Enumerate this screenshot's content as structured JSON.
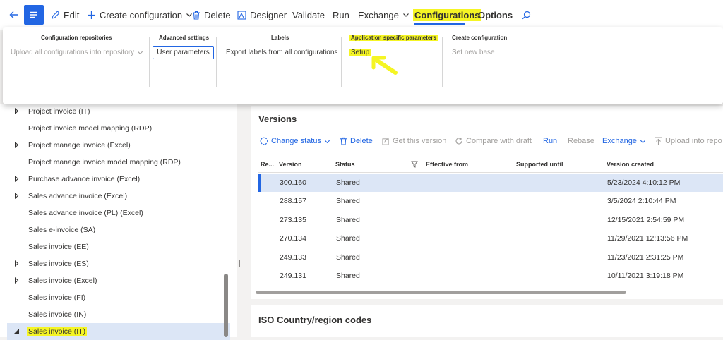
{
  "commandbar": {
    "edit": "Edit",
    "create_configuration": "Create configuration",
    "delete": "Delete",
    "designer": "Designer",
    "validate": "Validate",
    "run": "Run",
    "exchange": "Exchange",
    "configurations_tab": "Configurations",
    "options_tab": "Options"
  },
  "ribbon": {
    "groups": [
      {
        "title": "Configuration repositories",
        "items": [
          "Upload all configurations into repository"
        ]
      },
      {
        "title": "Advanced settings",
        "items": [
          "User parameters"
        ]
      },
      {
        "title": "Labels",
        "items": [
          "Export labels from all configurations"
        ]
      },
      {
        "title": "Application specific parameters",
        "items": [
          "Setup"
        ]
      },
      {
        "title": "Create configuration",
        "items": [
          "Set new base"
        ]
      }
    ]
  },
  "tree": {
    "items": [
      {
        "label": "Project invoice (IT)",
        "toggle": "collapsed"
      },
      {
        "label": "Project invoice model mapping (RDP)",
        "toggle": "none"
      },
      {
        "label": "Project manage invoice (Excel)",
        "toggle": "collapsed"
      },
      {
        "label": "Project manage invoice model mapping (RDP)",
        "toggle": "none"
      },
      {
        "label": "Purchase advance invoice (Excel)",
        "toggle": "collapsed"
      },
      {
        "label": "Sales advance invoice (Excel)",
        "toggle": "collapsed"
      },
      {
        "label": "Sales advance invoice (PL) (Excel)",
        "toggle": "none"
      },
      {
        "label": "Sales e-invoice (SA)",
        "toggle": "none"
      },
      {
        "label": "Sales invoice (EE)",
        "toggle": "none"
      },
      {
        "label": "Sales invoice (ES)",
        "toggle": "collapsed"
      },
      {
        "label": "Sales invoice (Excel)",
        "toggle": "collapsed"
      },
      {
        "label": "Sales invoice (FI)",
        "toggle": "none"
      },
      {
        "label": "Sales invoice (IN)",
        "toggle": "none"
      },
      {
        "label": "Sales invoice (IT)",
        "toggle": "expanded",
        "selected": true
      }
    ]
  },
  "versions": {
    "title": "Versions",
    "toolbar": {
      "change_status": "Change status",
      "delete": "Delete",
      "get_this_version": "Get this version",
      "compare_with_draft": "Compare with draft",
      "run": "Run",
      "rebase": "Rebase",
      "exchange": "Exchange",
      "upload_into_repo": "Upload into repo"
    },
    "columns": [
      "Re...",
      "Version",
      "Status",
      "Effective from",
      "Supported until",
      "Version created"
    ],
    "rows": [
      {
        "version": "300.160",
        "status": "Shared",
        "created": "5/23/2024 4:10:12 PM"
      },
      {
        "version": "288.157",
        "status": "Shared",
        "created": "3/5/2024 2:10:44 PM"
      },
      {
        "version": "273.135",
        "status": "Shared",
        "created": "12/15/2021 2:54:59 PM"
      },
      {
        "version": "270.134",
        "status": "Shared",
        "created": "11/29/2021 12:13:56 PM"
      },
      {
        "version": "249.133",
        "status": "Shared",
        "created": "11/23/2021 2:31:25 PM"
      },
      {
        "version": "249.131",
        "status": "Shared",
        "created": "10/11/2021 3:19:18 PM"
      }
    ]
  },
  "iso": {
    "title": "ISO Country/region codes"
  },
  "colors": {
    "accent": "#2266e3",
    "highlight": "#f5f524",
    "selection": "#dce6f6"
  }
}
